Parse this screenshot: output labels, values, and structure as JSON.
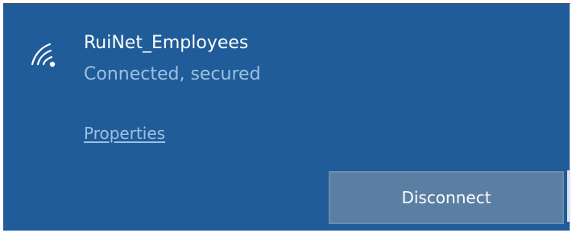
{
  "network": {
    "name": "RuiNet_Employees",
    "status": "Connected, secured",
    "icon": "wifi-secured-icon"
  },
  "actions": {
    "properties_label": "Properties",
    "disconnect_label": "Disconnect"
  },
  "colors": {
    "panel_background": "#1f5c99",
    "primary_text": "#ffffff",
    "secondary_text": "#9fc0df",
    "button_background": "#5b7fa3"
  }
}
